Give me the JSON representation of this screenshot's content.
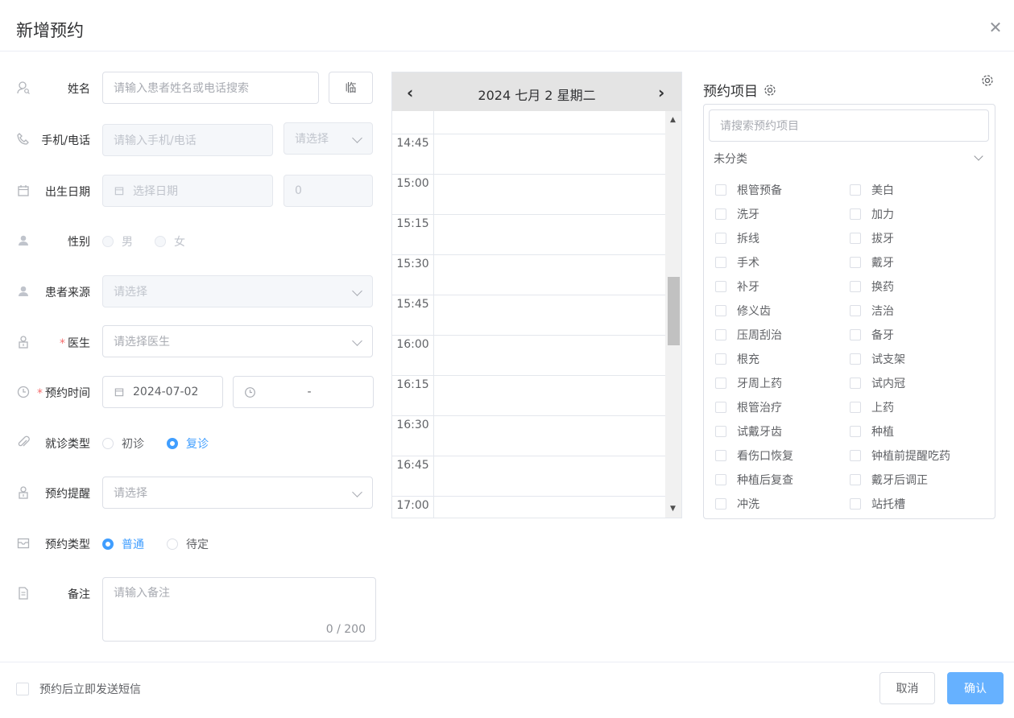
{
  "dialog": {
    "title": "新增预约"
  },
  "form": {
    "name": {
      "label": "姓名",
      "placeholder": "请输入患者姓名或电话搜索",
      "temp_button": "临"
    },
    "phone": {
      "label": "手机/电话",
      "placeholder": "请输入手机/电话",
      "select_placeholder": "请选择"
    },
    "birth": {
      "label": "出生日期",
      "placeholder": "选择日期",
      "age": "0"
    },
    "gender": {
      "label": "性别",
      "options": [
        "男",
        "女"
      ]
    },
    "source": {
      "label": "患者来源",
      "placeholder": "请选择"
    },
    "doctor": {
      "label": "医生",
      "required_mark": "*",
      "placeholder": "请选择医生"
    },
    "appt_time": {
      "label": "预约时间",
      "required_mark": "*",
      "date": "2024-07-02",
      "time": "-"
    },
    "visit_type": {
      "label": "就诊类型",
      "options": [
        "初诊",
        "复诊"
      ],
      "selected": "复诊"
    },
    "reminder": {
      "label": "预约提醒",
      "placeholder": "请选择"
    },
    "appt_type": {
      "label": "预约类型",
      "options": [
        "普通",
        "待定"
      ],
      "selected": "普通"
    },
    "remark": {
      "label": "备注",
      "placeholder": "请输入备注",
      "counter": "0 / 200"
    }
  },
  "calendar": {
    "title": "2024 七月 2 星期二",
    "prev": "‹",
    "next": "›",
    "slots": [
      "14:45",
      "15:00",
      "15:15",
      "15:30",
      "15:45",
      "16:00",
      "16:15",
      "16:30",
      "16:45",
      "17:00"
    ]
  },
  "items": {
    "title": "预约项目",
    "search_placeholder": "请搜索预约项目",
    "category": "未分类",
    "list": [
      [
        "根管预备",
        "美白"
      ],
      [
        "洗牙",
        "加力"
      ],
      [
        "拆线",
        "拔牙"
      ],
      [
        "手术",
        "戴牙"
      ],
      [
        "补牙",
        "换药"
      ],
      [
        "修义齿",
        "洁治"
      ],
      [
        "压周刮治",
        "备牙"
      ],
      [
        "根充",
        "试支架"
      ],
      [
        "牙周上药",
        "试内冠"
      ],
      [
        "根管治疗",
        "上药"
      ],
      [
        "试戴牙齿",
        "种植"
      ],
      [
        "看伤口恢复",
        "钟植前提醒吃药"
      ],
      [
        "种植后复查",
        "戴牙后调正"
      ],
      [
        "冲洗",
        "站托槽"
      ]
    ]
  },
  "footer": {
    "sms_label": "预约后立即发送短信",
    "cancel": "取消",
    "confirm": "确认"
  },
  "colors": {
    "primary": "#409eff",
    "primary_light": "#66b1ff",
    "required": "#f56c6c"
  }
}
